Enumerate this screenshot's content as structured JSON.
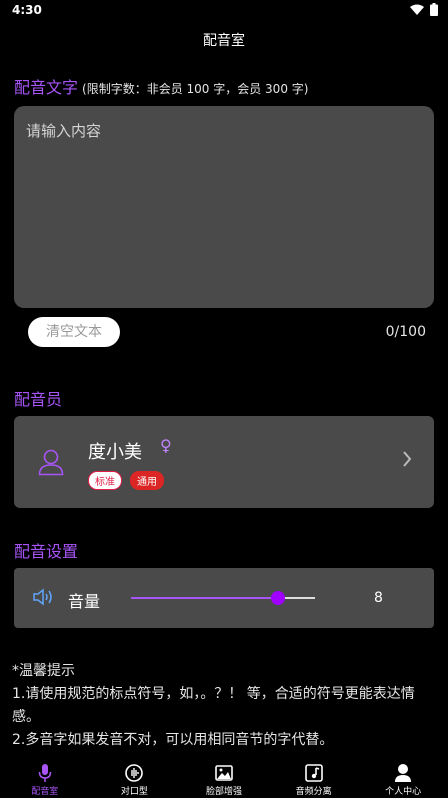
{
  "status": {
    "time": "4:30"
  },
  "header": {
    "title": "配音室"
  },
  "text_section": {
    "title": "配音文字",
    "note": "(限制字数：非会员 100 字，会员 300 字)",
    "placeholder": "请输入内容",
    "clear_label": "清空文本",
    "char_count": "0/100"
  },
  "voicer_section": {
    "title": "配音员",
    "name": "度小美",
    "gender_symbol": "♀",
    "tags": [
      "标准",
      "通用"
    ]
  },
  "settings_section": {
    "title": "配音设置",
    "volume_label": "音量",
    "volume_value": "8",
    "volume_fraction": 0.8
  },
  "tips": {
    "title": "*温馨提示",
    "line1": "1.请使用规范的标点符号，如，。？！ 等，合适的符号更能表达情感。",
    "line2": "2.多音字如果发音不对，可以用相同音节的字代替。"
  },
  "nav": {
    "items": [
      {
        "label": "配音室",
        "icon": "microphone-icon",
        "active": true
      },
      {
        "label": "对口型",
        "icon": "lipsync-icon",
        "active": false
      },
      {
        "label": "脸部增强",
        "icon": "face-enhance-icon",
        "active": false
      },
      {
        "label": "音频分离",
        "icon": "audio-split-icon",
        "active": false
      },
      {
        "label": "个人中心",
        "icon": "person-icon",
        "active": false
      }
    ]
  },
  "colors": {
    "accent": "#a855f7",
    "card": "#4a4a4a",
    "background": "#000000"
  }
}
